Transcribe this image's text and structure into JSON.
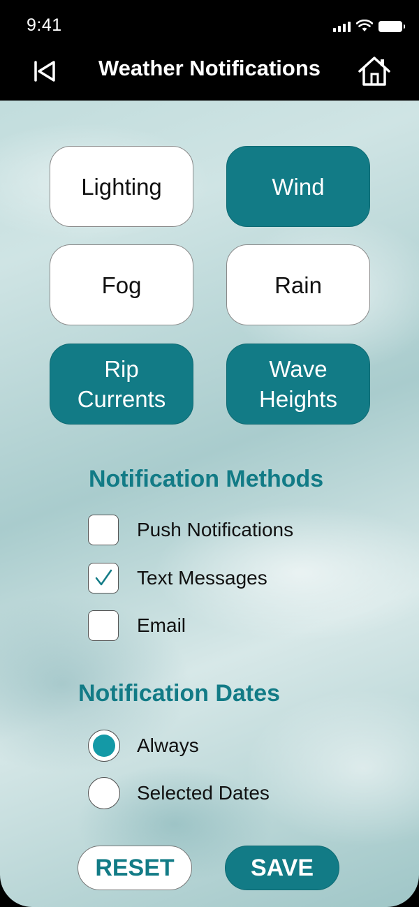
{
  "status_bar": {
    "time": "9:41"
  },
  "header": {
    "title": "Weather Notifications"
  },
  "alert_types": [
    {
      "label": "Lighting",
      "selected": false
    },
    {
      "label": "Wind",
      "selected": true
    },
    {
      "label": "Fog",
      "selected": false
    },
    {
      "label": "Rain",
      "selected": false
    },
    {
      "label": "Rip\nCurrents",
      "selected": true
    },
    {
      "label": "Wave\nHeights",
      "selected": true
    }
  ],
  "methods": {
    "title": "Notification Methods",
    "items": [
      {
        "label": "Push Notifications",
        "checked": false
      },
      {
        "label": "Text Messages",
        "checked": true
      },
      {
        "label": "Email",
        "checked": false
      }
    ]
  },
  "dates": {
    "title": "Notification Dates",
    "options": [
      {
        "label": "Always",
        "selected": true
      },
      {
        "label": "Selected Dates",
        "selected": false
      }
    ]
  },
  "actions": {
    "reset_label": "RESET",
    "save_label": "SAVE"
  },
  "colors": {
    "accent": "#127b86",
    "radio_fill": "#1499a6",
    "header_bg": "#000000"
  },
  "icons": {
    "back": "back-triangle-icon",
    "home": "home-icon",
    "checkmark": "checkmark-icon"
  }
}
